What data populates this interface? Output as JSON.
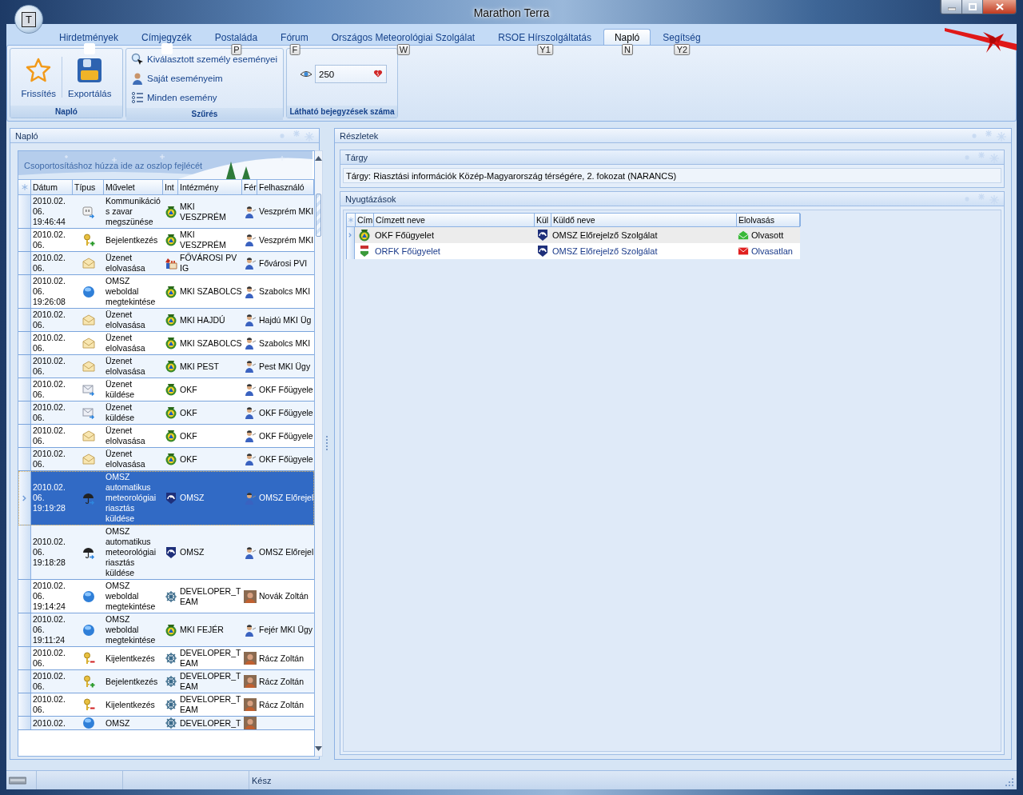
{
  "window": {
    "title": "Marathon Terra",
    "app_button": "T"
  },
  "tabs": [
    {
      "label": "Hirdetmények",
      "selected": false,
      "keytip": {
        "kind": "blank"
      }
    },
    {
      "label": "Címjegyzék",
      "selected": false,
      "keytip": {
        "kind": "blank"
      }
    },
    {
      "label": "Postaláda",
      "selected": false,
      "keytip": {
        "kind": "letter",
        "text": "P"
      }
    },
    {
      "label": "Fórum",
      "selected": false,
      "keytip": {
        "kind": "letter",
        "text": "F"
      }
    },
    {
      "label": "Országos Meteorológiai Szolgálat",
      "selected": false,
      "keytip": {
        "kind": "letter",
        "text": "W"
      }
    },
    {
      "label": "RSOE Hírszolgáltatás",
      "selected": false,
      "keytip": {
        "kind": "letter",
        "text": "Y1"
      }
    },
    {
      "label": "Napló",
      "selected": true,
      "keytip": {
        "kind": "letter",
        "text": "N"
      }
    },
    {
      "label": "Segítség",
      "selected": false,
      "keytip": {
        "kind": "letter",
        "text": "Y2"
      }
    }
  ],
  "ribbon_groups": [
    {
      "kind": "large",
      "label": "Napló",
      "buttons": [
        "Frissítés",
        "Exportálás"
      ]
    },
    {
      "kind": "small",
      "label": "Szűrés",
      "buttons": [
        "Kiválasztott személy eseményei",
        "Saját eseményeim",
        "Minden esemény"
      ]
    },
    {
      "kind": "count",
      "label": "Látható bejegyzések száma",
      "value": "250"
    }
  ],
  "log": {
    "title": "Napló",
    "group_hint": "Csoportosításhoz húzza ide az oszlop fejlécét",
    "columns": [
      "Dátum",
      "Típus",
      "Művelet",
      "Int",
      "Intézmény",
      "Fér",
      "Felhasználó"
    ],
    "rows": [
      {
        "selected": false,
        "date": "2010.02. 06. 19:46:44",
        "kind": "plug",
        "action": "Kommunikációs zavar megszünése",
        "org": {
          "kind": "mki",
          "name": "MKI VESZPRÉM"
        },
        "user": {
          "kind": "person",
          "name": "Veszprém MKI"
        }
      },
      {
        "selected": false,
        "date": "2010.02. 06.",
        "kind": "key_in",
        "action": "Bejelentkezés",
        "org": {
          "kind": "mki",
          "name": "MKI VESZPRÉM"
        },
        "user": {
          "kind": "person",
          "name": "Veszprém MKI"
        }
      },
      {
        "selected": false,
        "date": "2010.02. 06.",
        "kind": "mail_open",
        "action": "Üzenet elolvasása",
        "org": {
          "kind": "city",
          "name": "FŐVÁROSI PV IG"
        },
        "user": {
          "kind": "person",
          "name": "Fővárosi PVI"
        }
      },
      {
        "selected": false,
        "date": "2010.02. 06. 19:26:08",
        "kind": "globe",
        "action": "OMSZ weboldal megtekintése",
        "org": {
          "kind": "mki",
          "name": "MKI SZABOLCS"
        },
        "user": {
          "kind": "person",
          "name": "Szabolcs MKI"
        }
      },
      {
        "selected": false,
        "date": "2010.02. 06.",
        "kind": "mail_open",
        "action": "Üzenet elolvasása",
        "org": {
          "kind": "mki",
          "name": "MKI HAJDÚ"
        },
        "user": {
          "kind": "person",
          "name": "Hajdú MKI Üg"
        }
      },
      {
        "selected": false,
        "date": "2010.02. 06.",
        "kind": "mail_open",
        "action": "Üzenet elolvasása",
        "org": {
          "kind": "mki",
          "name": "MKI SZABOLCS"
        },
        "user": {
          "kind": "person",
          "name": "Szabolcs MKI"
        }
      },
      {
        "selected": false,
        "date": "2010.02. 06.",
        "kind": "mail_open",
        "action": "Üzenet elolvasása",
        "org": {
          "kind": "mki",
          "name": "MKI PEST"
        },
        "user": {
          "kind": "person",
          "name": "Pest MKI Ügy"
        }
      },
      {
        "selected": false,
        "date": "2010.02. 06.",
        "kind": "mail_send",
        "action": "Üzenet küldése",
        "org": {
          "kind": "mki",
          "name": "OKF"
        },
        "user": {
          "kind": "person",
          "name": "OKF Főügyele"
        }
      },
      {
        "selected": false,
        "date": "2010.02. 06.",
        "kind": "mail_send",
        "action": "Üzenet küldése",
        "org": {
          "kind": "mki",
          "name": "OKF"
        },
        "user": {
          "kind": "person",
          "name": "OKF Főügyele"
        }
      },
      {
        "selected": false,
        "date": "2010.02. 06.",
        "kind": "mail_open",
        "action": "Üzenet elolvasása",
        "org": {
          "kind": "mki",
          "name": "OKF"
        },
        "user": {
          "kind": "person",
          "name": "OKF Főügyele"
        }
      },
      {
        "selected": false,
        "date": "2010.02. 06.",
        "kind": "mail_open",
        "action": "Üzenet elolvasása",
        "org": {
          "kind": "mki",
          "name": "OKF"
        },
        "user": {
          "kind": "person",
          "name": "OKF Főügyele"
        }
      },
      {
        "selected": true,
        "date": "2010.02. 06. 19:19:28",
        "kind": "umbrella",
        "action": "OMSZ automatikus meteorológiai riasztás küldése",
        "org": {
          "kind": "omsz",
          "name": "OMSZ"
        },
        "user": {
          "kind": "person",
          "name": "OMSZ Előrejel"
        }
      },
      {
        "selected": false,
        "date": "2010.02. 06. 19:18:28",
        "kind": "umbrella",
        "action": "OMSZ automatikus meteorológiai riasztás küldése",
        "org": {
          "kind": "omsz",
          "name": "OMSZ"
        },
        "user": {
          "kind": "person",
          "name": "OMSZ Előrejel"
        }
      },
      {
        "selected": false,
        "date": "2010.02. 06. 19:14:24",
        "kind": "globe",
        "action": "OMSZ weboldal megtekintése",
        "org": {
          "kind": "wheel",
          "name": "DEVELOPER_TEAM"
        },
        "user": {
          "kind": "photo",
          "name": "Novák Zoltán"
        }
      },
      {
        "selected": false,
        "date": "2010.02. 06. 19:11:24",
        "kind": "globe",
        "action": "OMSZ weboldal megtekintése",
        "org": {
          "kind": "mki",
          "name": "MKI FEJÉR"
        },
        "user": {
          "kind": "person",
          "name": "Fejér MKI Ügy"
        }
      },
      {
        "selected": false,
        "date": "2010.02. 06.",
        "kind": "key_out",
        "action": "Kijelentkezés",
        "org": {
          "kind": "wheel",
          "name": "DEVELOPER_TEAM"
        },
        "user": {
          "kind": "photo",
          "name": "Rácz Zoltán"
        }
      },
      {
        "selected": false,
        "date": "2010.02. 06.",
        "kind": "key_in",
        "action": "Bejelentkezés",
        "org": {
          "kind": "wheel",
          "name": "DEVELOPER_TEAM"
        },
        "user": {
          "kind": "photo",
          "name": "Rácz Zoltán"
        }
      },
      {
        "selected": false,
        "date": "2010.02. 06.",
        "kind": "key_out",
        "action": "Kijelentkezés",
        "org": {
          "kind": "wheel",
          "name": "DEVELOPER_TEAM"
        },
        "user": {
          "kind": "photo",
          "name": "Rácz Zoltán"
        }
      },
      {
        "selected": false,
        "date": "2010.02.",
        "kind": "globe",
        "action": "OMSZ",
        "org": {
          "kind": "wheel",
          "name": "DEVELOPER_T"
        },
        "user": {
          "kind": "photo"
        }
      }
    ]
  },
  "details": {
    "title": "Részletek",
    "subject": {
      "title": "Tárgy",
      "text": "Tárgy: Riasztási információk Közép-Magyarország térségére, 2. fokozat (NARANCS)"
    },
    "acks": {
      "title": "Nyugtázások",
      "columns": [
        "Cím",
        "Címzett neve",
        "Kül",
        "Küldő neve",
        "Elolvasás"
      ],
      "rows": [
        {
          "selected": true,
          "read": true,
          "recipient": {
            "kind": "mki",
            "name": "OKF Főügyelet"
          },
          "sender": {
            "kind": "omsz",
            "name": "OMSZ Előrejelző Szolgálat"
          },
          "status": "Olvasott"
        },
        {
          "selected": false,
          "read": false,
          "recipient": {
            "kind": "police",
            "name": "ORFK Főügyelet"
          },
          "sender": {
            "kind": "omsz",
            "name": "OMSZ Előrejelző Szolgálat"
          },
          "status": "Olvasatlan"
        }
      ]
    }
  },
  "status_bar": {
    "text": "Kész"
  }
}
